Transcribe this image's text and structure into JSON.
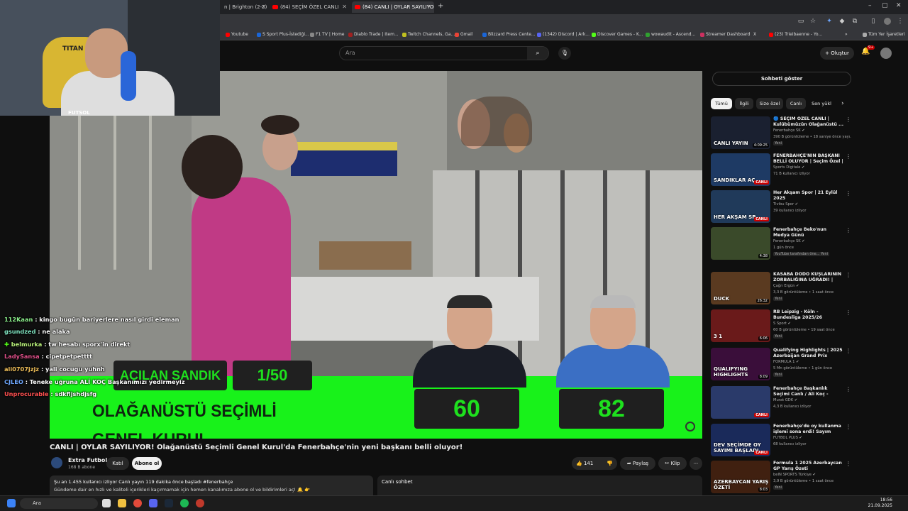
{
  "browser": {
    "tabs": [
      {
        "label": "n | Brighton (2-2)",
        "active": false
      },
      {
        "label": "(84) SEÇİM ÖZEL CANLI",
        "active": false
      },
      {
        "label": "(84) CANLI | OYLAR SAYILIYOR",
        "active": true
      }
    ],
    "new_tab": "+",
    "bookmarks": [
      "Youtube",
      "S Sport Plus-İstediği...",
      "F1 TV | Home",
      "Diablo Trade | Item...",
      "Twitch Channels, Ga...",
      "Gmail",
      "Blizzard Press Cente...",
      "(1342) Discord | Ark...",
      "Discover Games - K...",
      "wowaudit - Ascend...",
      "Streamer Dashboard",
      "X",
      "(23) Trieibaenne - Yo..."
    ],
    "all_bookmarks": "Tüm Yer İşaretleri"
  },
  "youtube": {
    "search_placeholder": "Ara",
    "create_label": "Oluştur",
    "notif_count": "9+"
  },
  "overlay": {
    "acilan_sandik": "AÇILAN SANDIK",
    "sandik_count": "1/50",
    "genel_kurul": "OLAĞANÜSTÜ SEÇİMLİ GENEL KURUL",
    "score_left": "60",
    "score_right": "82",
    "cam_chair_text": "TITAN",
    "cam_logo": "FUTSOL"
  },
  "chat": [
    {
      "user": "112Kaan",
      "msg": ": kingo bugün bariyerlere nasıl girdi eleman",
      "color": "#8cf08c"
    },
    {
      "user": "gsundzed",
      "msg": ": ne alaka",
      "color": "#7fe3c0"
    },
    {
      "user": "belmurka",
      "msg": ": tw hesabı sporx'in direkt",
      "color": "#b9f07a"
    },
    {
      "user": "LadySansa",
      "msg": ": cipetpetpetttt",
      "color": "#e0508a"
    },
    {
      "user": "ali0707jzjz",
      "msg": ": yali cocugu yuhnh",
      "color": "#f0c05a"
    },
    {
      "user": "CJLEO",
      "msg": ": Teneke uğruna ALİ KOÇ Başkanımızı yedirmeyiz",
      "color": "#6fa8ff"
    },
    {
      "user": "Unprocurable",
      "msg": ": sdkfljshdjsfg",
      "color": "#ff5050"
    }
  ],
  "video": {
    "title": "CANLI | OYLAR SAYILIYOR! Olağanüstü Seçimli Genel Kurul'da Fenerbahçe'nin yeni başkanı belli oluyor!",
    "channel": "Extra Futbol",
    "subs": "168 B abone",
    "join": "Katıl",
    "subscribe": "Abone ol",
    "likes": "141",
    "share": "Paylaş",
    "clip": "Klip",
    "desc_line1": "Şu an 1.455 kullanıcı izliyor  Canlı yayın 119 dakika önce başladı  #fenerbahçe",
    "desc_line2": "Gündeme dair en hızlı ve kaliteli içerikleri kaçırmamak için hemen kanalımıza abone ol ve bildirimleri aç! 🔔 👉",
    "live_chat": "Canlı sohbet"
  },
  "sidebar": {
    "show_chat": "Sohbeti göster",
    "chips": [
      "Tümü",
      "İlgili",
      "Size özel",
      "Canlı",
      "Son yükl"
    ],
    "items": [
      {
        "title": "🔵 SEÇİM ÖZEL CANLI | Kulübümüzün Olağanüstü ...",
        "channel": "Fenerbahçe SK ✔",
        "meta": "390 B görüntüleme • 18 saniye önce yayı...",
        "tag": "Yeni",
        "badge": "4:09:25",
        "thumb_text": "CANLI YAYIN",
        "thumb_color": "#1a2030"
      },
      {
        "title": "FENERBAHÇE'NİN BAŞKANI BELLİ OLUYOR | Seçim Özel | ...",
        "channel": "Sports Digitale ✔",
        "meta": "71 B kullanıcı izliyor",
        "tag": "",
        "badge": "CANLI",
        "thumb_text": "SANDIKLAR AÇ",
        "thumb_color": "#1e3a64"
      },
      {
        "title": "Her Akşam Spor | 21 Eylül 2025",
        "channel": "Tivibu Spor ✔",
        "meta": "39 kullanıcı izliyor",
        "tag": "",
        "badge": "CANLI",
        "thumb_text": "HER AKŞAM SP",
        "thumb_color": "#203a5a"
      },
      {
        "title": "Fenerbahçe Beko'nun Medya Günü",
        "channel": "Fenerbahçe SK ✔",
        "meta": "1 gün önce",
        "tag": "YouTube tarafından öne... Yeni",
        "badge": "4:38",
        "thumb_text": "",
        "thumb_color": "#3a4a2a"
      },
      {
        "title": "KASABA DODO KUŞLARININ ZORBALIĞINA UĞRADI! | Goos...",
        "channel": "Çağrı Ergün ✔",
        "meta": "3,3 B görüntüleme • 1 saat önce",
        "tag": "Yeni",
        "badge": "26:32",
        "thumb_text": "DUCK",
        "thumb_color": "#5a3a20"
      },
      {
        "title": "RB Leipzig - Köln - Bundesliga 2025/26",
        "channel": "S Sport ✔",
        "meta": "60 B görüntüleme • 19 saat önce",
        "tag": "Yeni",
        "badge": "6:06",
        "thumb_text": "3 1",
        "thumb_color": "#6a1a1a"
      },
      {
        "title": "Qualifying Highlights | 2025 Azerbaijan Grand Prix",
        "channel": "FORMULA 1 ✔",
        "meta": "5 Mn görüntüleme • 1 gün önce",
        "tag": "Yeni",
        "badge": "8:09",
        "thumb_text": "QUALIFYING HIGHLIGHTS",
        "thumb_color": "#3a0e3a"
      },
      {
        "title": "Fenerbahçe Başkanlık Seçimi Canlı / Ali Koç - Sadettin Saran",
        "channel": "Murat GDK ✔",
        "meta": "4,3 B kullanıcı izliyor",
        "tag": "",
        "badge": "CANLI",
        "thumb_text": "",
        "thumb_color": "#2a3a6a"
      },
      {
        "title": "Fenerbahçe'de oy kullanma işlemi sona erdi! Sayım başlad...",
        "channel": "FUTBOL PLUS ✔",
        "meta": "68 kullanıcı izliyor",
        "tag": "",
        "badge": "CANLI",
        "thumb_text": "DEV SEÇİMDE OY SAYIMI BAŞLADI",
        "thumb_color": "#1a2a5a"
      },
      {
        "title": "Formula 1 2025 Azerbaycan GP Yarış Özeti",
        "channel": "beIN SPORTS Türkiye ✔",
        "meta": "3,9 B görüntüleme • 1 saat önce",
        "tag": "Yeni",
        "badge": "8:03",
        "thumb_text": "AZERBAYCAN YARIŞ ÖZETİ",
        "thumb_color": "#402010"
      }
    ]
  },
  "taskbar": {
    "search": "Ara",
    "time": "18:56",
    "date": "21.09.2025"
  },
  "colors": {
    "green": "#18f21a",
    "youtube_red": "#ff0000",
    "dark": "#0f0f0f"
  }
}
